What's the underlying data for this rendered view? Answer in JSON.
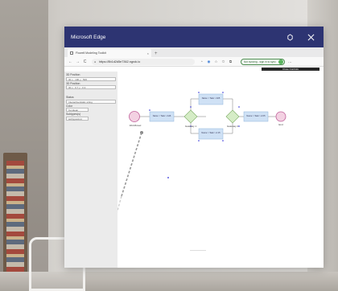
{
  "window": {
    "title": "Microsoft Edge",
    "buttons": {
      "restore_icon": "restore-icon",
      "close_icon": "close-icon"
    }
  },
  "tabs": [
    {
      "label": "Flowell Modeling Toolkit",
      "close": "×"
    }
  ],
  "new_tab": "+",
  "toolbar": {
    "back": "←",
    "forward": "→",
    "reload": "C",
    "url": "https://8b1d2d5e7362.ngrok.io",
    "sync_label": "Not syncing - sign in to sync",
    "more": "…"
  },
  "content": {
    "bar_label": "Close Controls",
    "side": {
      "position_label": "3D Position",
      "position_value": "30 x : 100 y : 500",
      "rotation_label": "3D Position",
      "rotation_value": "30 x : 0.7 y : 0.3",
      "status_label": "Status",
      "status_value": "Interactive/static string",
      "color_label": "Color",
      "color_value": "Cerulean",
      "subtype_label": "Subtypes(s)",
      "subtype_value": "subtypesList"
    },
    "diagram": {
      "start_label": "Workflowel",
      "task_main": "Name > Task > A46",
      "task_top": "Name > Task > A05",
      "task_bottom": "Name > Task > A 15",
      "task_right": "Name > Task > A 05",
      "gateway_left": "Gateway 1",
      "gateway_right": "Gateway 2",
      "end_label": "End"
    }
  },
  "colors": {
    "titlebar": "#2d3472",
    "event_fill": "#f3d1e2",
    "event_stroke": "#c0609a",
    "gateway_fill": "#d5ecc6",
    "gateway_stroke": "#7aab62",
    "task_fill": "#cfe1f5",
    "task_stroke": "#8fb3da",
    "handle": "#2b2bd8"
  }
}
